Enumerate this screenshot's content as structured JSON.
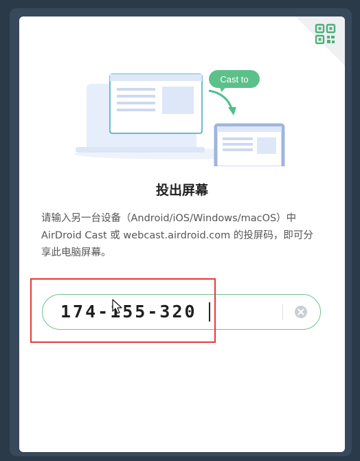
{
  "dialog": {
    "title": "投出屏幕",
    "description": "请输入另一台设备（Android/iOS/Windows/macOS）中 AirDroid Cast 或 webcast.airdroid.com 的投屏码，即可分享此电脑屏幕。",
    "cast_bubble_label": "Cast to",
    "qr_icon": "qr-code-icon"
  },
  "code_input": {
    "value": "174-155-320",
    "clear_icon": "clear-icon"
  },
  "colors": {
    "accent_green": "#5cc08a",
    "annotation_red": "#e53935",
    "frame": "#37495a"
  }
}
